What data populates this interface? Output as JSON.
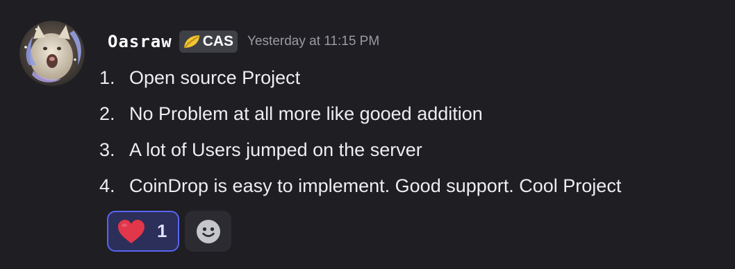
{
  "message": {
    "author": "Oasraw",
    "tag": {
      "icon": "leaf-icon",
      "label": "CAS"
    },
    "timestamp": "Yesterday at 11:15 PM",
    "items": [
      {
        "number": "1.",
        "text": "Open source Project"
      },
      {
        "number": "2.",
        "text": "No Problem at all more like gooed addition"
      },
      {
        "number": "3.",
        "text": "A lot of Users jumped on the server"
      },
      {
        "number": "4.",
        "text": "CoinDrop is easy to implement. Good support. Cool Project"
      }
    ],
    "reactions": [
      {
        "icon": "heart-icon",
        "count": "1"
      }
    ],
    "add_reaction_icon": "smile-icon"
  },
  "colors": {
    "background": "#1e1e23",
    "text": "#eeeef1",
    "timestamp": "#9a9ba2",
    "reaction_bg": "#2b2f5a",
    "reaction_border": "#5865f2",
    "heart": "#e2364a"
  }
}
